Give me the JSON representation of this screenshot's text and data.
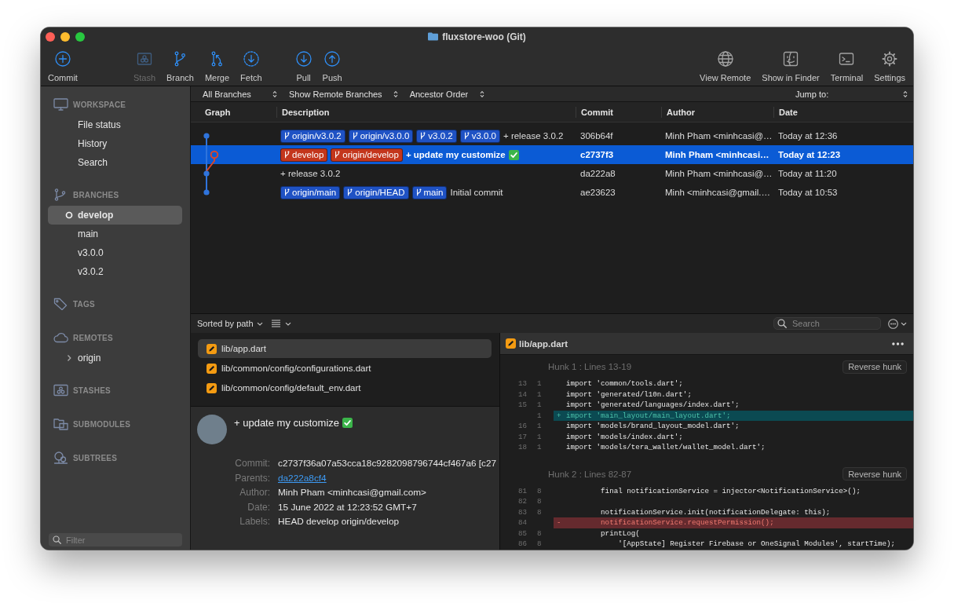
{
  "window": {
    "title": "fluxstore-woo (Git)"
  },
  "toolbar": {
    "groups": [
      [
        {
          "label": "Commit",
          "disabled": false
        }
      ],
      [
        {
          "label": "Stash",
          "disabled": true
        },
        {
          "label": "Branch",
          "disabled": false
        },
        {
          "label": "Merge",
          "disabled": false
        },
        {
          "label": "Fetch",
          "disabled": false
        }
      ],
      [
        {
          "label": "Pull",
          "disabled": false
        },
        {
          "label": "Push",
          "disabled": false
        }
      ],
      [
        {
          "label": "View Remote",
          "disabled": false
        },
        {
          "label": "Show in Finder",
          "disabled": false
        },
        {
          "label": "Terminal",
          "disabled": false
        },
        {
          "label": "Settings",
          "disabled": false
        }
      ]
    ]
  },
  "sidebar": {
    "sections": [
      {
        "title": "WORKSPACE",
        "items": [
          {
            "label": "File status",
            "selected": false
          },
          {
            "label": "History",
            "selected": false
          },
          {
            "label": "Search",
            "selected": false
          }
        ]
      },
      {
        "title": "BRANCHES",
        "items": [
          {
            "label": "develop",
            "selected": true,
            "current": true
          },
          {
            "label": "main",
            "selected": false,
            "current": false
          },
          {
            "label": "v3.0.0",
            "selected": false,
            "current": false
          },
          {
            "label": "v3.0.2",
            "selected": false,
            "current": false
          }
        ]
      },
      {
        "title": "TAGS"
      },
      {
        "title": "REMOTES",
        "items": [
          {
            "label": "origin",
            "selected": false,
            "expanded": false
          }
        ]
      },
      {
        "title": "STASHES"
      },
      {
        "title": "SUBMODULES"
      },
      {
        "title": "SUBTREES"
      }
    ],
    "filter": {
      "placeholder": "Filter"
    }
  },
  "history": {
    "filters": [
      {
        "label": "All Branches"
      },
      {
        "label": "Show Remote Branches"
      },
      {
        "label": "Ancestor Order"
      }
    ],
    "jump_to": "Jump to:",
    "columns": [
      "Graph",
      "Description",
      "Commit",
      "Author",
      "Date"
    ],
    "commits": [
      {
        "refs": [
          {
            "name": "origin/v3.0.2",
            "color": "#1f52c4"
          },
          {
            "name": "origin/v3.0.0",
            "color": "#1f52c4"
          },
          {
            "name": "v3.0.2",
            "color": "#1f52c4"
          },
          {
            "name": "v3.0.0",
            "color": "#1f52c4"
          }
        ],
        "message": "+ release 3.0.2",
        "check_mark": false,
        "hash": "306b64f",
        "author": "Minh Pham <minhcasi@…",
        "date": "Today at 12:36",
        "selected": false,
        "color": "#2f74dc",
        "side_lane": false,
        "head": false
      },
      {
        "refs": [
          {
            "name": "develop",
            "color": "#c3361c"
          },
          {
            "name": "origin/develop",
            "color": "#c3361c"
          }
        ],
        "message": "+ update my customize",
        "check_mark": true,
        "hash": "c2737f3",
        "author": "Minh Pham <minhcasi…",
        "date": "Today at 12:23",
        "selected": true,
        "color": "#d9472b",
        "side_lane": true,
        "head": true
      },
      {
        "message": "+ release 3.0.2",
        "check_mark": false,
        "hash": "da222a8",
        "author": "Minh Pham <minhcasi@…",
        "date": "Today at 11:20",
        "selected": false,
        "color": "#2f74dc",
        "side_lane": false,
        "head": false
      },
      {
        "refs": [
          {
            "name": "origin/main",
            "color": "#1f52c4"
          },
          {
            "name": "origin/HEAD",
            "color": "#1f52c4"
          },
          {
            "name": "main",
            "color": "#1f52c4"
          }
        ],
        "message": "Initial commit",
        "check_mark": false,
        "hash": "ae23623",
        "author": "Minh <minhcasi@gmail.…",
        "date": "Today at 10:53",
        "selected": false,
        "color": "#2f74dc",
        "side_lane": false,
        "head": false
      }
    ]
  },
  "changes": {
    "sort": "Sorted by path",
    "search": {
      "placeholder": "Search"
    },
    "files": [
      {
        "path": "lib/app.dart",
        "kind": "modified",
        "selected": true
      },
      {
        "path": "lib/common/config/configurations.dart",
        "kind": "modified",
        "selected": false
      },
      {
        "path": "lib/common/config/default_env.dart",
        "kind": "modified",
        "selected": false
      }
    ],
    "details": {
      "subject": "+ update my customize",
      "check_mark": true,
      "fields": [
        {
          "label": "Commit:",
          "value": "c2737f36a07a53cca18c9282098796744cf467a6 [c27",
          "kind": "text"
        },
        {
          "label": "Parents:",
          "value": "da222a8cf4",
          "kind": "link"
        },
        {
          "label": "Author:",
          "value": "Minh Pham <minhcasi@gmail.com>",
          "kind": "text"
        },
        {
          "label": "Date:",
          "value": "15 June 2022 at 12:23:52 GMT+7",
          "kind": "text"
        },
        {
          "label": "Labels:",
          "value": "HEAD develop origin/develop",
          "kind": "text"
        }
      ]
    }
  },
  "diff": {
    "file": {
      "path": "lib/app.dart",
      "kind": "modified"
    },
    "hunks": [
      {
        "title": "Hunk 1 : Lines 13-19",
        "action": "Reverse hunk",
        "lines": [
          {
            "kind": "context",
            "old": "13",
            "new": "1",
            "code": "import 'common/tools.dart';"
          },
          {
            "kind": "context",
            "old": "14",
            "new": "1",
            "code": "import 'generated/l10n.dart';"
          },
          {
            "kind": "context",
            "old": "15",
            "new": "1",
            "code": "import 'generated/languages/index.dart';"
          },
          {
            "kind": "added",
            "new": "1",
            "sign": "+",
            "code": "import 'main_layout/main_layout.dart';"
          },
          {
            "kind": "context",
            "old": "16",
            "new": "1",
            "code": "import 'models/brand_layout_model.dart';"
          },
          {
            "kind": "context",
            "old": "17",
            "new": "1",
            "code": "import 'models/index.dart';"
          },
          {
            "kind": "context",
            "old": "18",
            "new": "1",
            "code": "import 'models/tera_wallet/wallet_model.dart';"
          }
        ]
      },
      {
        "title": "Hunk 2 : Lines 82-87",
        "action": "Reverse hunk",
        "lines": [
          {
            "kind": "context",
            "old": "81",
            "new": "8",
            "code": "        final notificationService = injector<NotificationService>();"
          },
          {
            "kind": "context",
            "old": "82",
            "new": "8"
          },
          {
            "kind": "context",
            "old": "83",
            "new": "8",
            "code": "        notificationService.init(notificationDelegate: this);"
          },
          {
            "kind": "removed",
            "old": "84",
            "sign": "-",
            "code": "        notificationService.requestPermission();"
          },
          {
            "kind": "context",
            "old": "85",
            "new": "8",
            "code": "        printLog("
          },
          {
            "kind": "context",
            "old": "86",
            "new": "8",
            "code": "            '[AppState] Register Firebase or OneSignal Modules', startTime);"
          }
        ]
      }
    ]
  }
}
